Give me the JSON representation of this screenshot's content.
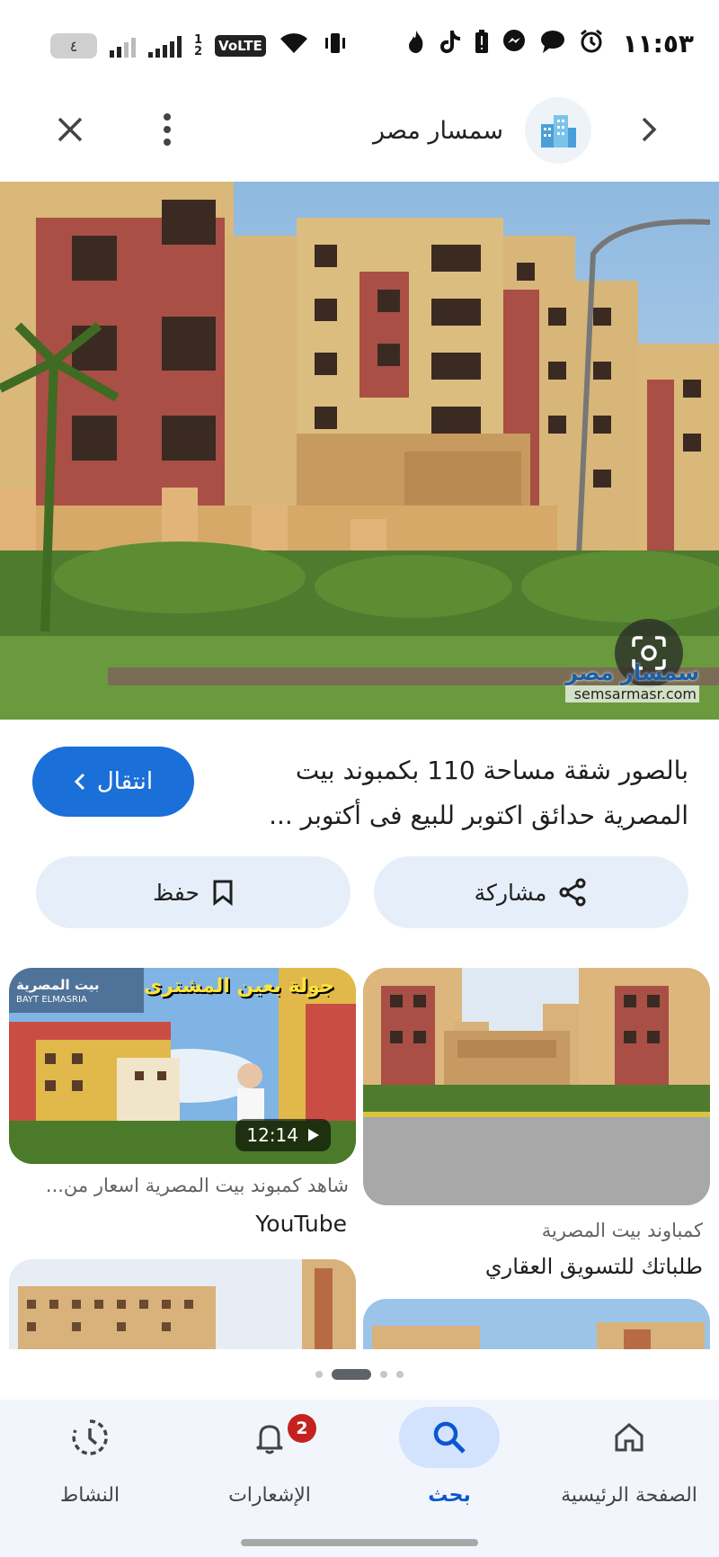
{
  "status_bar": {
    "time": "١١:٥٣",
    "battery_level": "٤",
    "sim2_label": "1\n2",
    "volte": "VoLTE"
  },
  "header": {
    "site_name": "سمسار مصر"
  },
  "hero": {
    "watermark_arabic": "سمسار مصر",
    "watermark_url": "semsarmasr.com"
  },
  "result": {
    "title": "بالصور شقة مساحة 110 بكمبوند بيت المصرية حدائق اكتوبر للبيع فى أكتوبر ...",
    "visit_label": "انتقال",
    "share_label": "مشاركة",
    "save_label": "حفظ"
  },
  "related": [
    {
      "overlay_text": "جولة بعين المشترى",
      "brand_text": "بيت المصرية",
      "brand_sub": "BAYT ELMASRIA",
      "duration": "12:14",
      "caption": "شاهد كمبوند بيت المصرية اسعار من...",
      "source": "YouTube"
    },
    {
      "caption": "كمباوند بيت المصرية",
      "source": "طلباتك للتسويق العقاري"
    }
  ],
  "bottom_nav": {
    "items": [
      {
        "label": "الصفحة الرئيسية",
        "icon": "home-icon"
      },
      {
        "label": "بحث",
        "icon": "search-icon",
        "active": true
      },
      {
        "label": "الإشعارات",
        "icon": "bell-icon",
        "badge": "2"
      },
      {
        "label": "النشاط",
        "icon": "activity-history-icon"
      }
    ]
  },
  "colors": {
    "accent": "#1a6fd8",
    "chip_background": "#e6eef9",
    "nav_background": "#f2f6fc",
    "nav_active_pill": "#d3e3fd",
    "badge_red": "#c5221f"
  }
}
